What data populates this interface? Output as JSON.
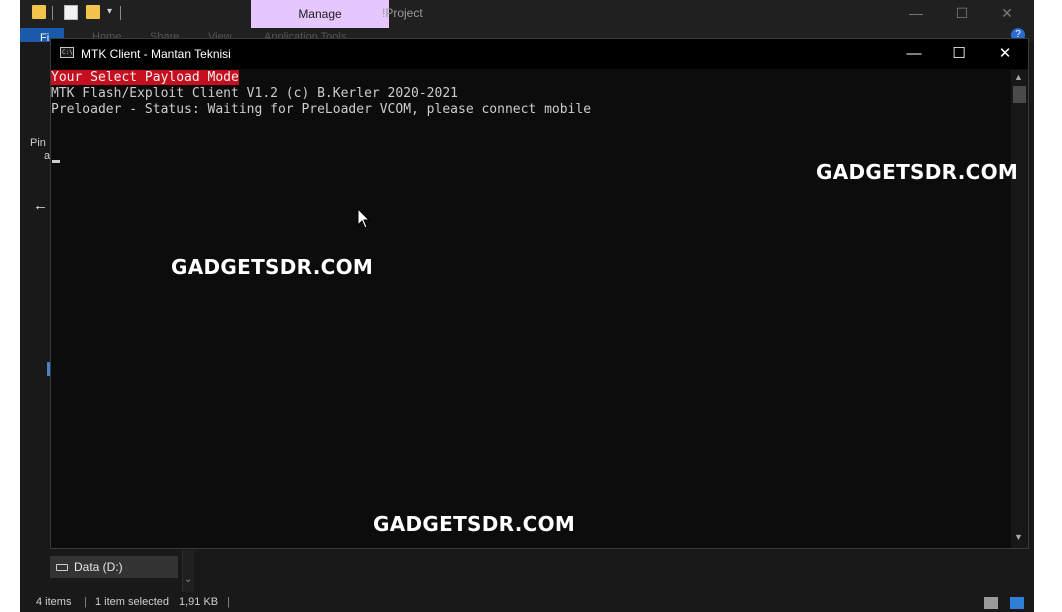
{
  "explorer": {
    "title": "!Project",
    "contextual_tab": "Manage",
    "ribbon": {
      "file_tab": "Fi",
      "ghost_tabs": [
        "Home",
        "Share",
        "View",
        "Application Tools"
      ]
    },
    "nav_pane": {
      "pin_text": "Pin",
      "pin_text_2": "a",
      "drive_label": "Data (D:)"
    },
    "status": {
      "items": "4 items",
      "selected": "1 item selected",
      "size": "1,91 KB"
    },
    "help_label": "?"
  },
  "console": {
    "title": "MTK Client -  Mantan Teknisi",
    "icon_label": "C:\\",
    "lines": {
      "highlighted": "Your Select Payload Mode",
      "line2": "MTK Flash/Exploit Client V1.2 (c) B.Kerler 2020-2021",
      "line3": "Preloader - Status: Waiting for PreLoader VCOM, please connect mobile"
    },
    "colors": {
      "background": "#0c0c0c",
      "text": "#cccccc",
      "highlight_bg": "#c50f1f"
    }
  },
  "watermarks": {
    "top_right": "GADGETSDR.COM",
    "middle_left": "GADGETSDR.COM",
    "bottom_center": "GADGETSDR.COM"
  },
  "colors": {
    "manage_tab": "#e5c6ff",
    "file_tab": "#1a5aaa"
  }
}
